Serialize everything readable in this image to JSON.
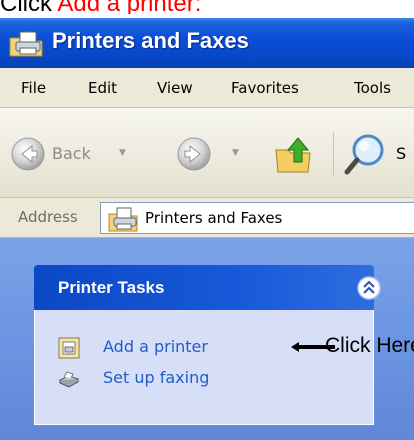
{
  "instruction": {
    "prefix": "Click ",
    "highlight": "Add a printer:"
  },
  "window": {
    "title": "Printers and Faxes",
    "title_icon": "printer-folder-icon"
  },
  "menubar": {
    "items": [
      "File",
      "Edit",
      "View",
      "Favorites",
      "Tools"
    ]
  },
  "toolbar": {
    "back_label": "Back",
    "search_label": "S",
    "icons": [
      "back-arrow-icon",
      "forward-arrow-icon",
      "up-folder-icon",
      "search-icon"
    ]
  },
  "address": {
    "label": "Address",
    "value": "Printers and Faxes"
  },
  "tasks": {
    "title": "Printer Tasks",
    "items": [
      {
        "label": "Add a printer",
        "icon": "add-printer-icon"
      },
      {
        "label": "Set up faxing",
        "icon": "fax-icon"
      }
    ],
    "annotation": "Click Here"
  },
  "colors": {
    "title_bar": "#0a4fd8",
    "task_header": "#0c48c6",
    "task_body": "#d6dff7",
    "link": "#215dc6",
    "highlight": "#ff0000",
    "pane": "#6b95e2"
  }
}
